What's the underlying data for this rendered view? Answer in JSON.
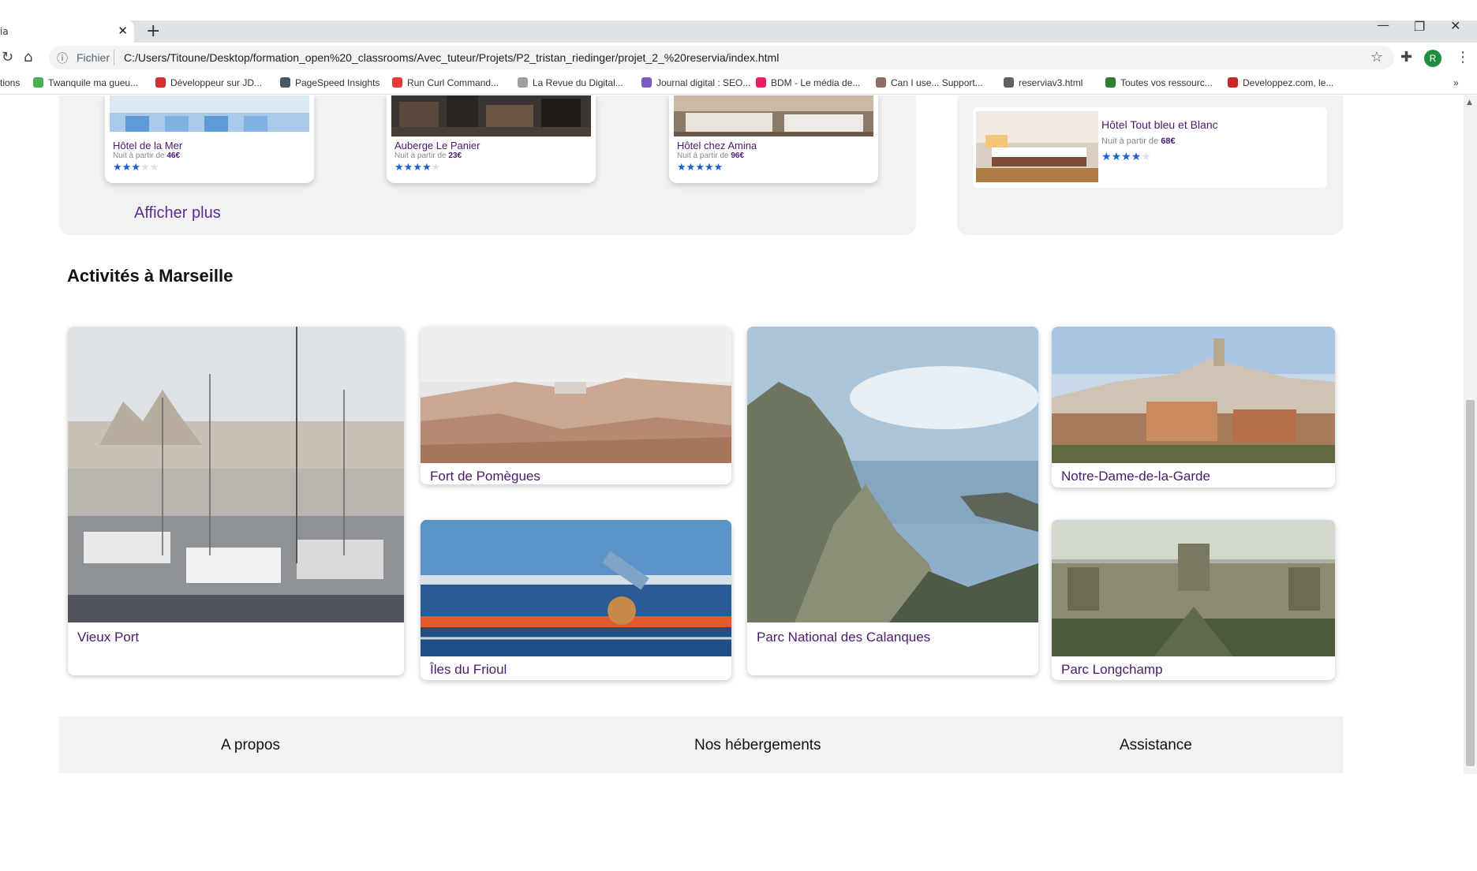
{
  "browser": {
    "tab_title": "ia",
    "scheme_label": "Fichier",
    "url": "C:/Users/Titoune/Desktop/formation_open%20_classrooms/Avec_tuteur/Projets/P2_tristan_riedinger/projet_2_%20reservia/index.html",
    "avatar_initial": "R",
    "bookmarks": [
      {
        "label": "tions",
        "color": ""
      },
      {
        "label": "Twanquile ma gueu...",
        "color": "#4caf50"
      },
      {
        "label": "Développeur sur JD...",
        "color": "#d32f2f"
      },
      {
        "label": "PageSpeed Insights",
        "color": "#455a64"
      },
      {
        "label": "Run Curl Command...",
        "color": "#e53935"
      },
      {
        "label": "La Revue du Digital...",
        "color": "#9e9e9e"
      },
      {
        "label": "Journal digital : SEO...",
        "color": "#7e57c2"
      },
      {
        "label": "BDM - Le média de...",
        "color": "#e91e63"
      },
      {
        "label": "Can I use... Support...",
        "color": "#8d6e63"
      },
      {
        "label": "reserviav3.html",
        "color": "#616161"
      },
      {
        "label": "Toutes vos ressourc...",
        "color": "#2e7d32"
      },
      {
        "label": "Developpez.com, le...",
        "color": "#c62828"
      }
    ],
    "more_bookmarks": "»"
  },
  "hotels": [
    {
      "name": "Hôtel de la Mer",
      "price_prefix": "Nuit à partir de ",
      "price": "46€",
      "rating": 3
    },
    {
      "name": "Auberge Le Panier",
      "price_prefix": "Nuit à partir de ",
      "price": "23€",
      "rating": 4
    },
    {
      "name": "Hôtel chez Amina",
      "price_prefix": "Nuit à partir de ",
      "price": "96€",
      "rating": 5
    }
  ],
  "show_more": "Afficher plus",
  "side_hotel": {
    "name": "Hôtel Tout bleu et Blanc",
    "price_prefix": "Nuit à partir de ",
    "price": "68€",
    "rating": 4
  },
  "activities_title": "Activités à Marseille",
  "activities": [
    {
      "label": "Vieux Port"
    },
    {
      "label": "Fort de Pomègues"
    },
    {
      "label": "Îles du Frioul"
    },
    {
      "label": "Parc National des Calanques"
    },
    {
      "label": "Notre-Dame-de-la-Garde"
    },
    {
      "label": "Parc Longchamp"
    }
  ],
  "footer": {
    "links": [
      "A propos",
      "Nos hébergements",
      "Assistance"
    ]
  },
  "colors": {
    "accent": "#4b1a6e",
    "link": "#5a2d91",
    "star": "#1a5fd6",
    "panel": "#f2f2f2"
  }
}
